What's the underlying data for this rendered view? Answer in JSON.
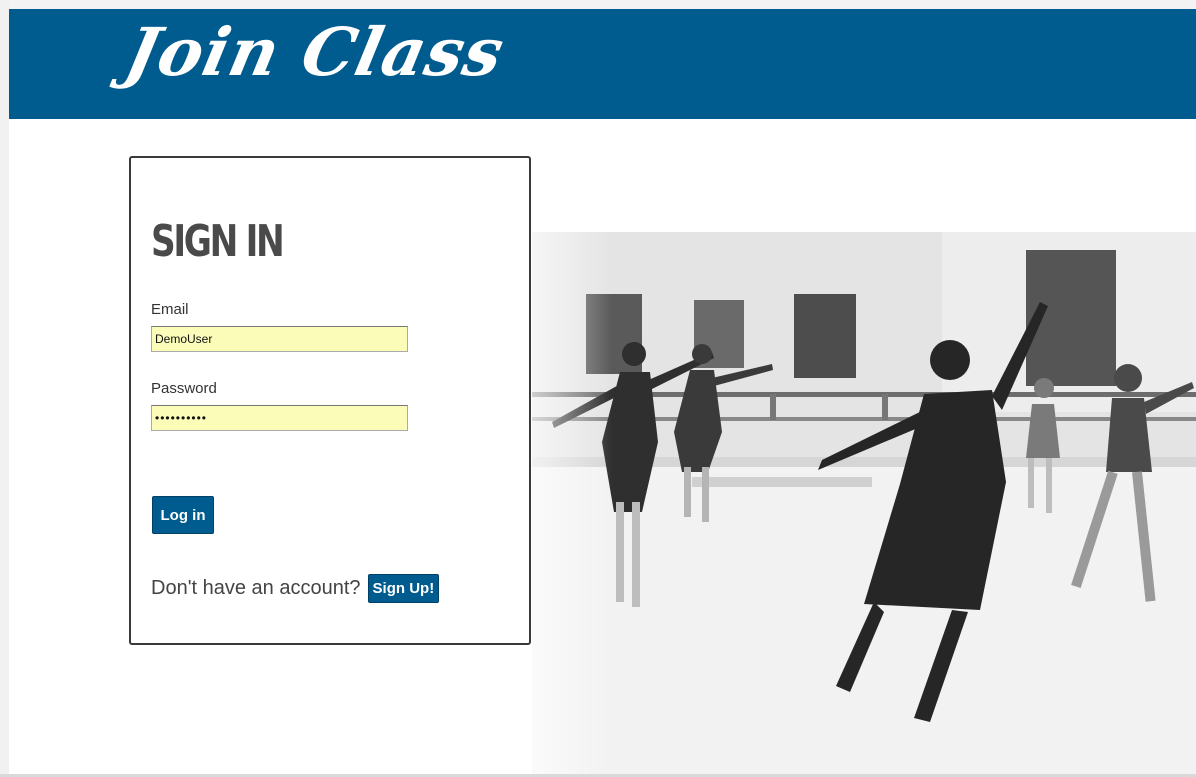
{
  "header": {
    "logo_text": "Join Class",
    "background_color": "#005b8f"
  },
  "signin": {
    "title": "SIGN IN",
    "email_label": "Email",
    "email_value": "DemoUser",
    "password_label": "Password",
    "password_value": "••••••••••",
    "login_button": "Log in",
    "signup_prompt": "Don't have an account?",
    "signup_button": "Sign Up!"
  },
  "colors": {
    "accent": "#005b8f",
    "autofill_bg": "#fafcb8",
    "title_gray": "#4a4a4a"
  }
}
